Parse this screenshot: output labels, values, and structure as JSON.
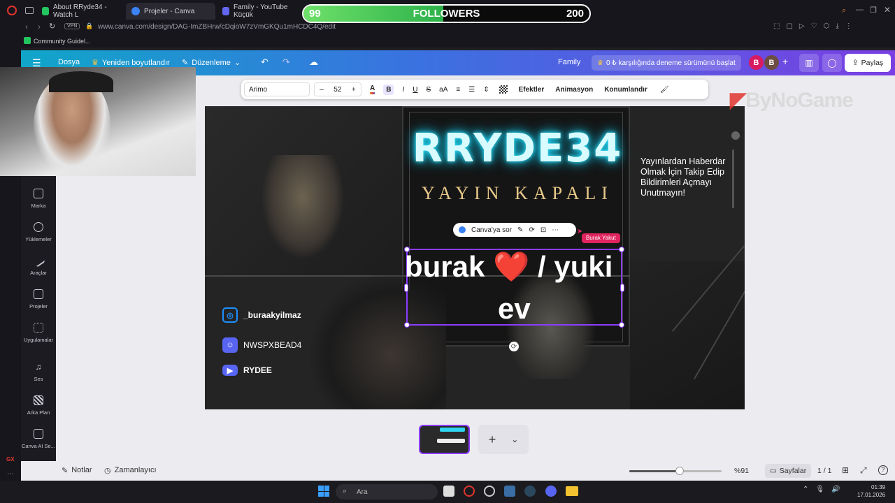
{
  "browser": {
    "tabs": [
      {
        "label": "About RRyde34 - Watch L",
        "color": "#22c55e"
      },
      {
        "label": "Projeler - Canva",
        "color": "#3b82f6"
      },
      {
        "label": "Family - YouTube Küçük",
        "color": "#6366f1"
      }
    ],
    "vpn": "VPN",
    "url": "www.canva.com/design/DAG-ImZBHrw/cDqioW7zVmGKQu1mHCDC4Q/edit",
    "bookmark": "Community Guidel..."
  },
  "stream": {
    "followers_label": "FOLLOWERS",
    "followers_current": "99",
    "followers_goal": "200",
    "progress_fraction": 0.49,
    "bynogame": "ByNoGame"
  },
  "canva": {
    "menu": {
      "file": "Dosya",
      "resize": "Yeniden boyutlandır",
      "edit": "Düzenleme"
    },
    "design_name": "Family",
    "trial": "0 ₺ karşılığında deneme sürümünü başlat",
    "avatars": [
      "B",
      "B"
    ],
    "share": "Paylaş",
    "sidebar": [
      {
        "label": "Marka"
      },
      {
        "label": "Yüklemeler"
      },
      {
        "label": "Araçlar"
      },
      {
        "label": "Projeler"
      },
      {
        "label": "Uygulamalar"
      },
      {
        "label": "Ses"
      },
      {
        "label": "Arka Plan"
      },
      {
        "label": "Canva AI Se..."
      }
    ],
    "toolbar": {
      "font": "Arimo",
      "minus": "–",
      "size": "52",
      "plus": "+",
      "effects": "Efektler",
      "animation": "Animasyon",
      "position": "Konumlandır"
    },
    "design": {
      "neon_title": "RRYDE34",
      "subtitle": "YAYIN KAPALI",
      "text_line1": "burak ❤️ / yuki",
      "text_line2": "ev",
      "ask_canva": "Canva'ya sor",
      "collaborator": "Burak Yakut",
      "follow_message": "Yayınlardan Haberdar Olmak İçin Takip Edip Bildirimleri Açmayı Unutmayın!",
      "socials": [
        {
          "icon": "instagram-icon",
          "handle": "_buraakyilmaz",
          "color": "#1e90ff"
        },
        {
          "icon": "discord-icon",
          "handle": "NWSPXBEAD4",
          "color": "#5865f2"
        },
        {
          "icon": "youtube-icon",
          "handle": "RYDEE",
          "color": "#5865f2"
        }
      ]
    },
    "bottom": {
      "notes": "Notlar",
      "timer": "Zamanlayıcı",
      "zoom": "%91",
      "pages": "Sayfalar",
      "page_count": "1 / 1"
    }
  },
  "taskbar": {
    "search": "Ara",
    "time": "01:39",
    "date": "17.01.2026"
  }
}
